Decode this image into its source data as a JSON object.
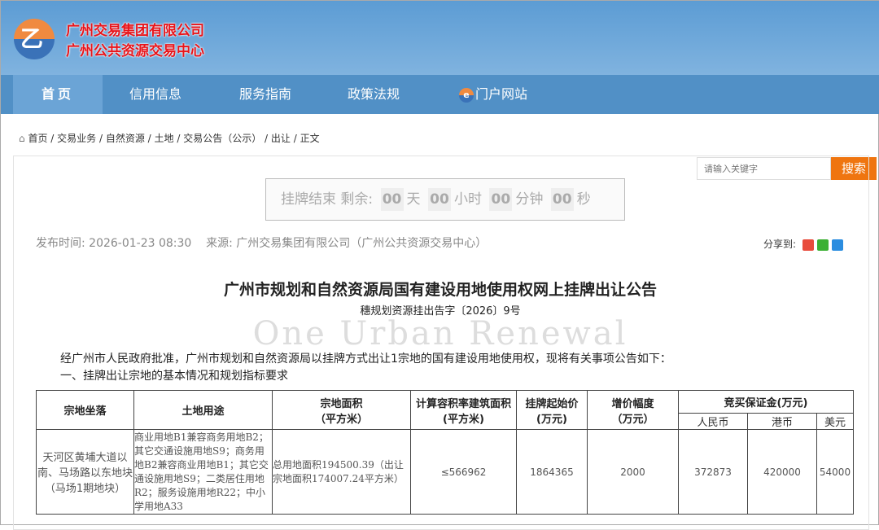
{
  "brand": {
    "line1": "广州交易集团有限公司",
    "line2": "广州公共资源交易中心",
    "logo_glyph": "乙"
  },
  "nav": {
    "items": [
      "首页",
      "信用信息",
      "服务指南",
      "政策法规",
      "门户网站"
    ],
    "search_placeholder": "请输入关键字",
    "search_button": "搜索"
  },
  "breadcrumb": [
    "首页",
    "交易业务",
    "自然资源",
    "土地",
    "交易公告（公示）",
    "出让",
    "正文"
  ],
  "countdown": {
    "label": "挂牌结束  剩余:",
    "days": "00",
    "days_unit": "天",
    "hours": "00",
    "hours_unit": "小时",
    "minutes": "00",
    "minutes_unit": "分钟",
    "seconds": "00",
    "seconds_unit": "秒"
  },
  "meta": {
    "publish": "发布时间: 2026-01-23 08:30",
    "source": "来源: 广州交易集团有限公司（广州公共资源交易中心）",
    "share_label": "分享到:"
  },
  "article": {
    "title": "广州市规划和自然资源局国有建设用地使用权网上挂牌出让公告",
    "doc_no": "穗规划资源挂出告字〔2026〕9号",
    "watermark": "One Urban Renewal",
    "para1": "经广州市人民政府批准，广州市规划和自然资源局以挂牌方式出让1宗地的国有建设用地使用权，现将有关事项公告如下：",
    "para2": "一、挂牌出让宗地的基本情况和规划指标要求"
  },
  "table": {
    "headers": {
      "location": "宗地坐落",
      "use": "土地用途",
      "area": "宗地面积\n（平方米）",
      "gfa": "计算容积率建筑面积\n(平方米)",
      "price": "挂牌起始价\n(万元)",
      "increment": "增价幅度\n（万元）",
      "deposit": "竞买保证金(万元)",
      "rmb": "人民币",
      "hkd": "港币",
      "usd": "美元"
    },
    "row": {
      "location": "天河区黄埔大道以南、马场路以东地块（马场1期地块）",
      "use": "商业用地B1兼容商务用地B2；其它交通设施用地S9；商务用地B2兼容商业用地B1；其它交通设施用地S9；二类居住用地R2；服务设施用地R22；中小学用地A33",
      "area": "总用地面积194500.39（出让宗地面积174007.24平方米）",
      "gfa": "≤566962",
      "price": "1864365",
      "increment": "2000",
      "rmb": "372873",
      "hkd": "420000",
      "usd": "54000"
    }
  }
}
